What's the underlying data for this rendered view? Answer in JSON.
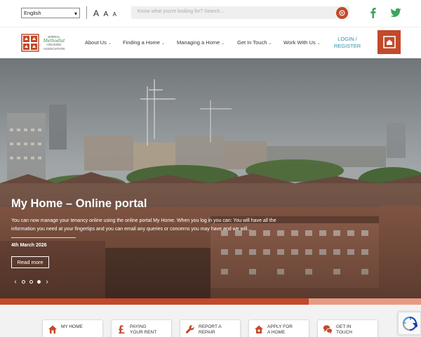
{
  "language_select": {
    "value": "English"
  },
  "text_size": {
    "large": "A",
    "medium": "A",
    "small": "A"
  },
  "search": {
    "placeholder": "Know what you're looking for? Search..."
  },
  "social": {
    "facebook": "facebook-icon",
    "twitter": "twitter-icon"
  },
  "logo": {
    "line1": "WIRRAL",
    "line2": "Methodist",
    "line3": "HOUSING",
    "line4": "ASSOCIATION"
  },
  "nav": {
    "items": [
      {
        "label": "About Us"
      },
      {
        "label": "Finding a Home"
      },
      {
        "label": "Managing a Home"
      },
      {
        "label": "Get In Touch"
      },
      {
        "label": "Work With Us"
      }
    ],
    "login_line1": "LOGIN /",
    "login_line2": "REGISTER"
  },
  "hero": {
    "title": "My Home – Online portal",
    "description": "You can now manage your tenancy online using the online portal My Home.  When you log in you can:  You will have all the information you need at your fingertips and you can email any queries or concerns you may have and we will...",
    "date": "4th March 2026",
    "read_more": "Read more",
    "prev": "‹",
    "next": "›",
    "slides_total": 3,
    "slide_active": 3
  },
  "colors": {
    "brand": "#c24a2a",
    "brand_light": "#e89a82",
    "link": "#2f8fa8",
    "social": "#3aa55e"
  },
  "quick_links": [
    {
      "line1": "MY HOME",
      "line2": ""
    },
    {
      "line1": "PAYING",
      "line2": "YOUR RENT"
    },
    {
      "line1": "REPORT A",
      "line2": "REPAIR"
    },
    {
      "line1": "APPLY FOR",
      "line2": "A HOME"
    },
    {
      "line1": "GET IN",
      "line2": "TOUCH"
    }
  ]
}
